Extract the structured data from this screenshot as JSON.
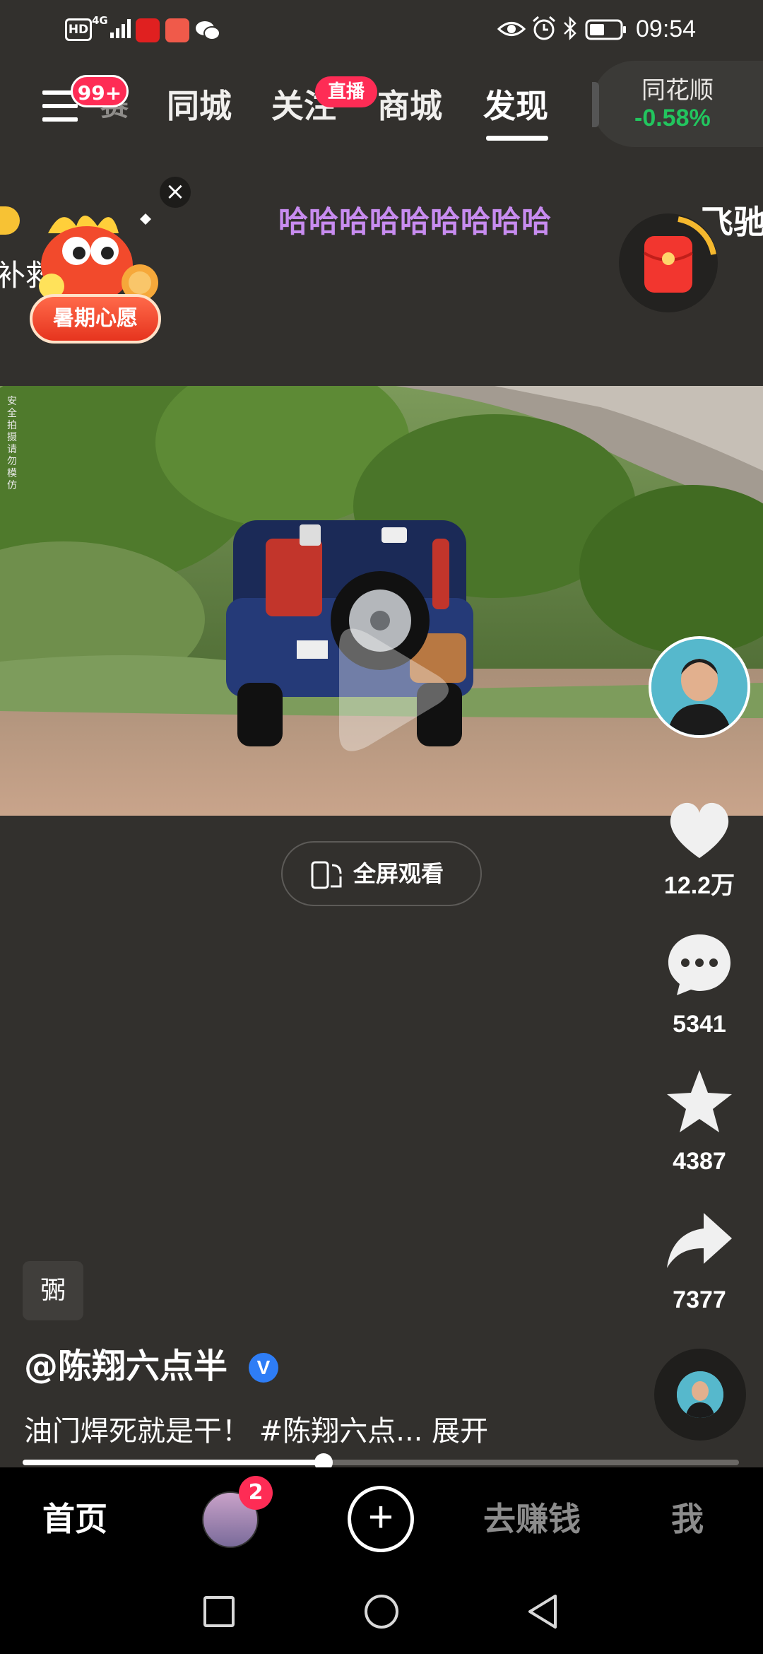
{
  "status_bar": {
    "hd": "HD",
    "network": "4G",
    "time": "09:54"
  },
  "top_nav": {
    "menu_badge": "99+",
    "tabs": [
      {
        "label": "同城"
      },
      {
        "label": "关注",
        "badge": "直播"
      },
      {
        "label": "商城"
      },
      {
        "label": "发现",
        "active": true
      }
    ],
    "stock_widget": {
      "name": "同花顺",
      "change": "-0.58%",
      "change_color": "#22c55e"
    }
  },
  "overlay": {
    "wish_button": "暑期心愿",
    "danmu_left": "补救",
    "danmu_center": "哈哈哈哈哈哈哈哈哈",
    "danmu_right": "飞驰"
  },
  "video": {
    "watermark": "安全拍摄 请勿模仿",
    "fullscreen_label": "全屏观看"
  },
  "actions": {
    "likes": "12.2万",
    "comments": "5341",
    "favorites": "4387",
    "shares": "7377"
  },
  "caption": {
    "topic_chip": "弻",
    "author": "@陈翔六点半",
    "text": "油门焊死就是干！ #陈翔六点... 展开",
    "progress": 0.42
  },
  "bottom_nav": {
    "home": "首页",
    "friends_badge": "2",
    "add": "+",
    "earn": "去赚钱",
    "me": "我"
  },
  "colors": {
    "accent": "#fe2c55",
    "background": "#32302d"
  }
}
